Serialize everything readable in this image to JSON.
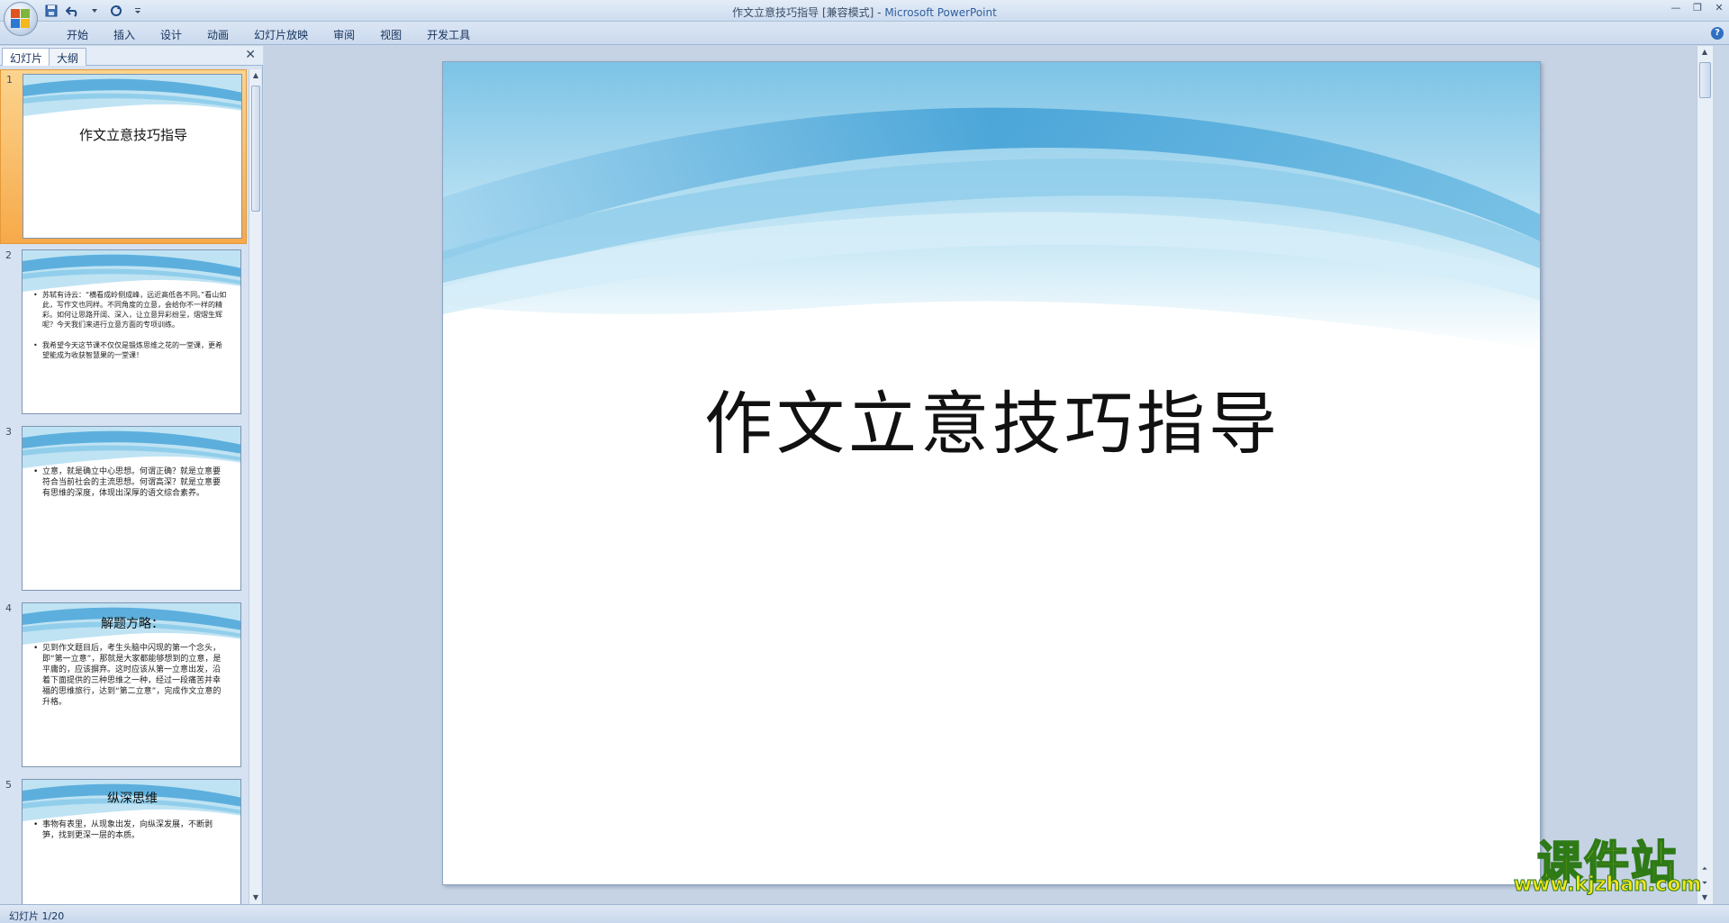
{
  "window": {
    "title": "作文立意技巧指导 [兼容模式] - ",
    "app_name": "Microsoft PowerPoint",
    "controls": {
      "minimize": "—",
      "maximize": "❐",
      "close": "✕"
    }
  },
  "quick_access": {
    "icons": [
      "save-icon",
      "undo-icon",
      "redo-icon",
      "customize-icon"
    ]
  },
  "ribbon": {
    "tabs": [
      "开始",
      "插入",
      "设计",
      "动画",
      "幻灯片放映",
      "审阅",
      "视图",
      "开发工具"
    ],
    "help": "?"
  },
  "left_pane": {
    "tabs": [
      "幻灯片",
      "大纲"
    ],
    "close": "✕",
    "slides": [
      {
        "number": "1",
        "title": "作文立意技巧指导",
        "bullets": []
      },
      {
        "number": "2",
        "title": "",
        "bullets": [
          "苏轼有诗云：“横看成岭侧成峰，远近高低各不同。”看山如此，写作文也同样。不同角度的立意，会给你不一样的精彩。如何让思路开阔、深入，让立意异彩纷呈，熠熠生辉呢？今天我们来进行立意方面的专项训练。",
          "我希望今天这节课不仅仅是锻炼思维之花的一堂课，更希望能成为收获智慧果的一堂课！"
        ]
      },
      {
        "number": "3",
        "title": "",
        "bullets": [
          "立意，就是确立中心思想。何谓正确？就是立意要符合当前社会的主流思想。何谓高深？就是立意要有思维的深度，体现出深厚的语文综合素养。"
        ]
      },
      {
        "number": "4",
        "title": "解题方略：",
        "bullets": [
          "见到作文题目后，考生头脑中闪现的第一个念头，即“第一立意”，那就是大家都能够想到的立意，是平庸的，应该摒弃。这时应该从第一立意出发，沿着下面提供的三种思维之一种，经过一段痛苦并幸福的思维旅行，达到“第二立意”，完成作文立意的升格。"
        ]
      },
      {
        "number": "5",
        "title": "纵深思维",
        "bullets": [
          "事物有表里，从现象出发，向纵深发展，不断剥笋，找到更深一层的本质。"
        ]
      }
    ]
  },
  "main_slide": {
    "title": "作文立意技巧指导"
  },
  "status_bar": {
    "slide_indicator": "幻灯片 1/20"
  },
  "watermark": {
    "main": "课件站",
    "url": "www.kjzhan.com"
  },
  "colors": {
    "accent": "#2f5f9e",
    "selection": "#f7a949",
    "wave_dark": "#4aa6d8",
    "wave_light": "#cfe9f6"
  }
}
